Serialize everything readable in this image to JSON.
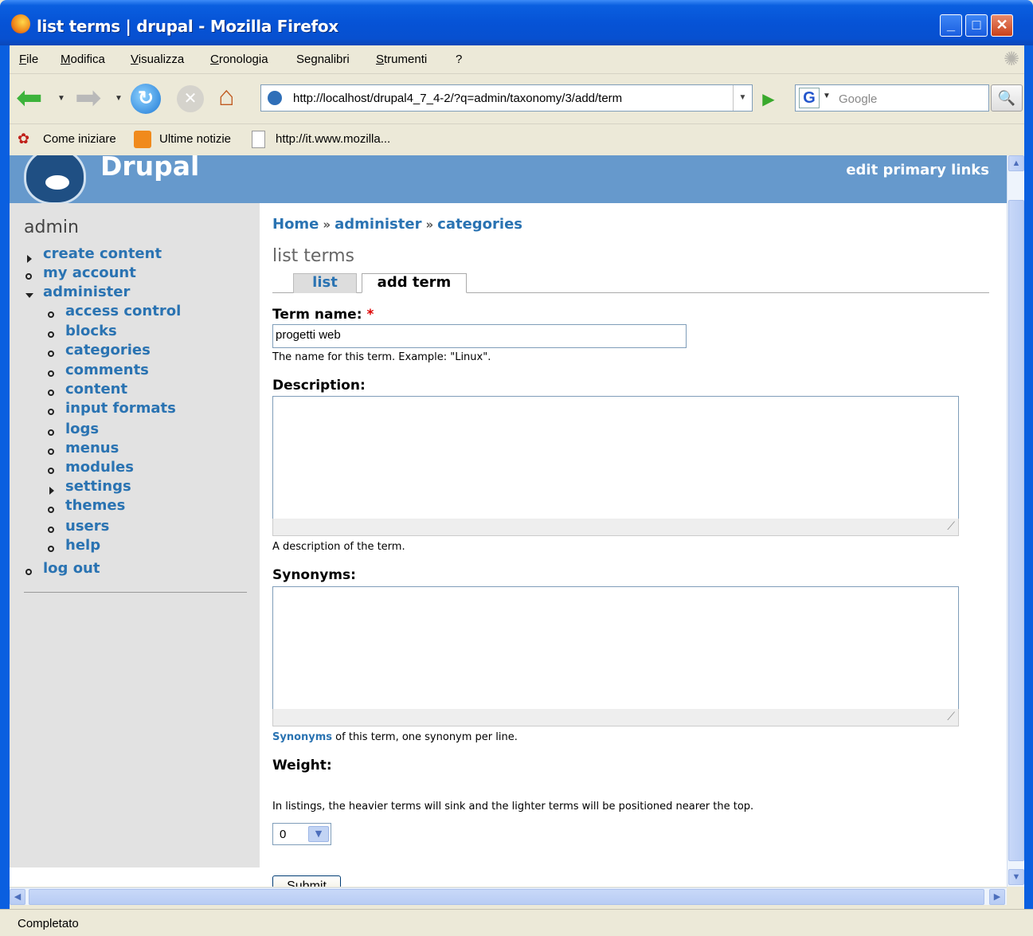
{
  "window": {
    "title": "list terms | drupal - Mozilla Firefox",
    "min_glyph": "_",
    "max_glyph": "□",
    "close_glyph": "✕"
  },
  "menubar": [
    "File",
    "Modifica",
    "Visualizza",
    "Cronologia",
    "Segnalibri",
    "Strumenti",
    "?"
  ],
  "toolbar": {
    "url": "http://localhost/drupal4_7_4-2/?q=admin/taxonomy/3/add/term",
    "search_placeholder": "Google",
    "search_engine_glyph": "G"
  },
  "bookmarks": [
    "Come iniziare",
    "Ultime notizie",
    "http://it.www.mozilla..."
  ],
  "site": {
    "name": "Drupal",
    "primary_links": "edit primary links"
  },
  "sidebar": {
    "title": "admin",
    "items": [
      {
        "label": "create content",
        "bullet": "tri-r",
        "level": 0
      },
      {
        "label": "my account",
        "bullet": "o",
        "level": 0
      },
      {
        "label": "administer",
        "bullet": "tri-d",
        "level": 0
      },
      {
        "label": "access control",
        "bullet": "o",
        "level": 1
      },
      {
        "label": "blocks",
        "bullet": "o",
        "level": 1
      },
      {
        "label": "categories",
        "bullet": "o",
        "level": 1
      },
      {
        "label": "comments",
        "bullet": "o",
        "level": 1
      },
      {
        "label": "content",
        "bullet": "o",
        "level": 1
      },
      {
        "label": "input formats",
        "bullet": "o",
        "level": 1
      },
      {
        "label": "logs",
        "bullet": "o",
        "level": 1
      },
      {
        "label": "menus",
        "bullet": "o",
        "level": 1
      },
      {
        "label": "modules",
        "bullet": "o",
        "level": 1
      },
      {
        "label": "settings",
        "bullet": "tri-r",
        "level": 1
      },
      {
        "label": "themes",
        "bullet": "o",
        "level": 1
      },
      {
        "label": "users",
        "bullet": "o",
        "level": 1
      },
      {
        "label": "help",
        "bullet": "o",
        "level": 1
      },
      {
        "label": "log out",
        "bullet": "o",
        "level": 0
      }
    ]
  },
  "breadcrumb": [
    "Home",
    "administer",
    "categories"
  ],
  "breadcrumb_sep": "»",
  "page": {
    "title": "list terms",
    "tabs": [
      "list",
      "add term"
    ]
  },
  "form": {
    "term_name_label": "Term name:",
    "required_mark": "*",
    "term_name_value": "progetti web",
    "term_name_desc": "The name for this term. Example: \"Linux\".",
    "description_label": "Description:",
    "description_desc": "A description of the term.",
    "synonyms_label": "Synonyms:",
    "synonyms_link": "Synonyms",
    "synonyms_desc": " of this term, one synonym per line.",
    "weight_label": "Weight:",
    "weight_value": "0",
    "weight_desc": "In listings, the heavier terms will sink and the lighter terms will be positioned nearer the top.",
    "submit_label": "Submit"
  },
  "status": "Completato",
  "colors": {
    "header": "#6699cc",
    "link": "#2a73b2",
    "sidebar": "#e2e2e2"
  }
}
